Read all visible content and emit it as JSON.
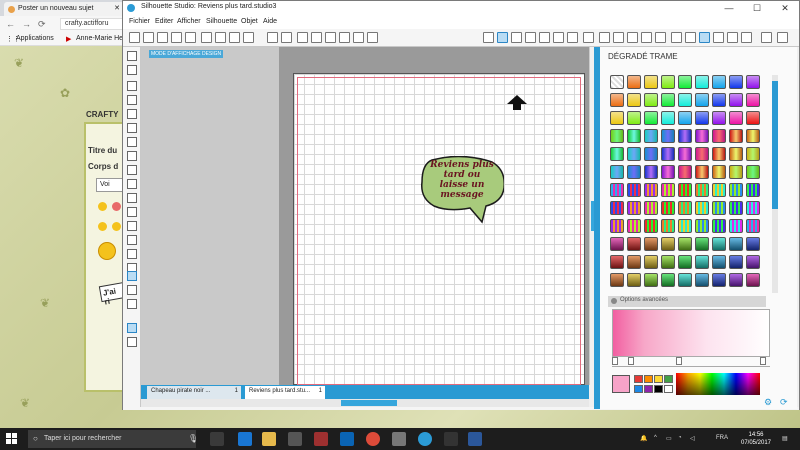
{
  "browser": {
    "tab_title": "Poster un nouveau sujet",
    "url": "crafty.actiffoгu",
    "bookmarks": [
      "Applications",
      "Anne-Marie Hensma"
    ],
    "crafty_label": "CRAFTY",
    "post_labels": [
      "Titre du",
      "Corps d"
    ],
    "post_button": "Voi",
    "sticker_text": "J'ai ri"
  },
  "window": {
    "title": "Silhouette Studio: Reviens plus tard.studio3",
    "menu": [
      "Fichier",
      "Editer",
      "Afficher",
      "Silhouette",
      "Objet",
      "Aide"
    ],
    "controls": [
      "—",
      "☐",
      "✕"
    ]
  },
  "canvas": {
    "mode_label": "MODE D'AFFICHAGE DESIGN",
    "bubble_text": "Reviens plus tard ou laisse un message"
  },
  "doc_tabs": [
    {
      "label": "Chapeau pirate noir ...",
      "close": "1"
    },
    {
      "label": "Reviens plus tard.stu...",
      "close": "1"
    }
  ],
  "panel": {
    "title": "DÉGRADÉ TRAME",
    "advanced_label": "Options avancées"
  },
  "taskbar": {
    "search_placeholder": "Taper ici pour rechercher",
    "language": "FRA",
    "time": "14:56",
    "date": "07/05/2017"
  },
  "colors": {
    "accent": "#2a9ad3",
    "bubble_fill": "#a8cb7c",
    "bubble_text": "#6a1420"
  }
}
